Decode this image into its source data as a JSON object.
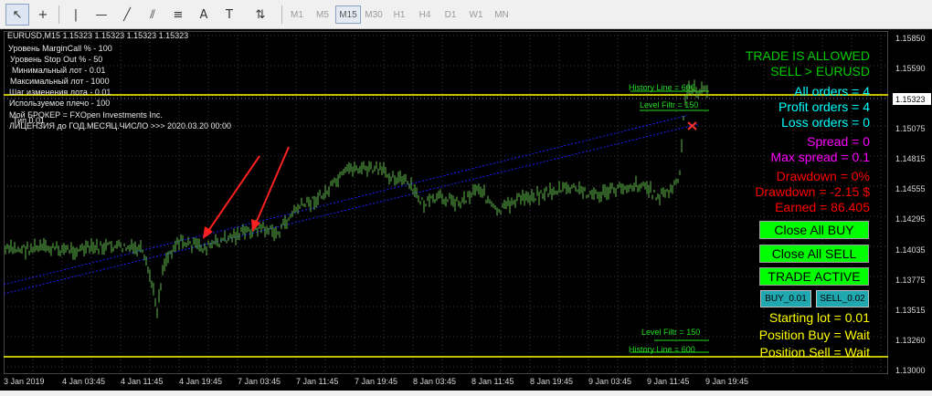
{
  "toolbar": {
    "tools": [
      {
        "icon": "cursor-icon",
        "glyph": "↖"
      },
      {
        "icon": "crosshair-icon",
        "glyph": "+"
      },
      {
        "icon": "vertical-line-icon",
        "glyph": "|"
      },
      {
        "icon": "horizontal-line-icon",
        "glyph": "—"
      },
      {
        "icon": "trendline-icon",
        "glyph": "╱"
      },
      {
        "icon": "equidistant-channel-icon",
        "glyph": "⫽"
      },
      {
        "icon": "fibonacci-icon",
        "glyph": "≡"
      },
      {
        "icon": "text-icon",
        "glyph": "A"
      },
      {
        "icon": "text-label-icon",
        "glyph": "T"
      },
      {
        "icon": "arrows-icon",
        "glyph": "⇅"
      }
    ],
    "timeframes": [
      "M1",
      "M5",
      "M15",
      "M30",
      "H1",
      "H4",
      "D1",
      "W1",
      "MN"
    ],
    "active_timeframe": "M15"
  },
  "info": {
    "symbol_line": "EURUSD,M15  1.15323 1.15323 1.15323 1.15323",
    "lines": [
      "Уровень MarginCall % -  100",
      "Уровень Stop Out % -  50",
      "Минимальный лот -  0.01",
      "Максимальный лот -  1000",
      "Шаг изменения лота -  0.01",
      "Используемое плечо -  100",
      "Мой БРОКЕР  =  FXOpen Investments Inc.",
      "ЛИЦЕНЗИЯ до ГОД.МЕСЯЦ.ЧИСЛО >>> 2020.03.20 00:00"
    ],
    "overlap_text": "Тип 0.01"
  },
  "panel": {
    "trade_allowed": "TRADE IS ALLOWED",
    "sell_symbol": "SELL > EURUSD",
    "all_orders": "All orders = 4",
    "profit_orders": "Profit orders = 4",
    "loss_orders": "Loss orders = 0",
    "spread": "Spread =  0",
    "max_spread": "Max spread = 0.1",
    "drawdown_pct": "Drawdown  = 0%",
    "drawdown_usd": "Drawdown = -2.15 $",
    "earned": "Earned = 86.405",
    "close_all_buy": "Close All BUY",
    "close_all_sell": "Close All SELL",
    "trade_active": "TRADE ACTIVE",
    "buy_btn": "BUY_0.01",
    "sell_btn": "SELL_0.02",
    "starting_lot": "Starting lot = 0.01",
    "position_buy": "Position Buy = Wait",
    "position_sell": "Position Sell = Wait",
    "colors": {
      "green": "#00cc00",
      "cyan": "#00ffff",
      "magenta": "#ff00ff",
      "red": "#ff0000",
      "yellow": "#ffff00",
      "button_green": "#00ff00",
      "button_teal": "#1fa8b0"
    }
  },
  "lines": {
    "history_top": "History Line = 600",
    "level_filtr_top": "Level Filtr = 150",
    "level_filtr_bottom": "Level Filtr = 150",
    "history_bottom": "History Line = 600"
  },
  "price_axis": {
    "labels": [
      "1.15850",
      "1.15590",
      "1.15075",
      "1.14815",
      "1.14555",
      "1.14295",
      "1.14035",
      "1.13775",
      "1.13515",
      "1.13260",
      "1.13000"
    ],
    "current": "1.15323"
  },
  "time_axis": [
    "3 Jan 2019",
    "4 Jan 03:45",
    "4 Jan 11:45",
    "4 Jan 19:45",
    "7 Jan 03:45",
    "7 Jan 11:45",
    "7 Jan 19:45",
    "8 Jan 03:45",
    "8 Jan 11:45",
    "8 Jan 19:45",
    "9 Jan 03:45",
    "9 Jan 11:45",
    "9 Jan 19:45"
  ]
}
